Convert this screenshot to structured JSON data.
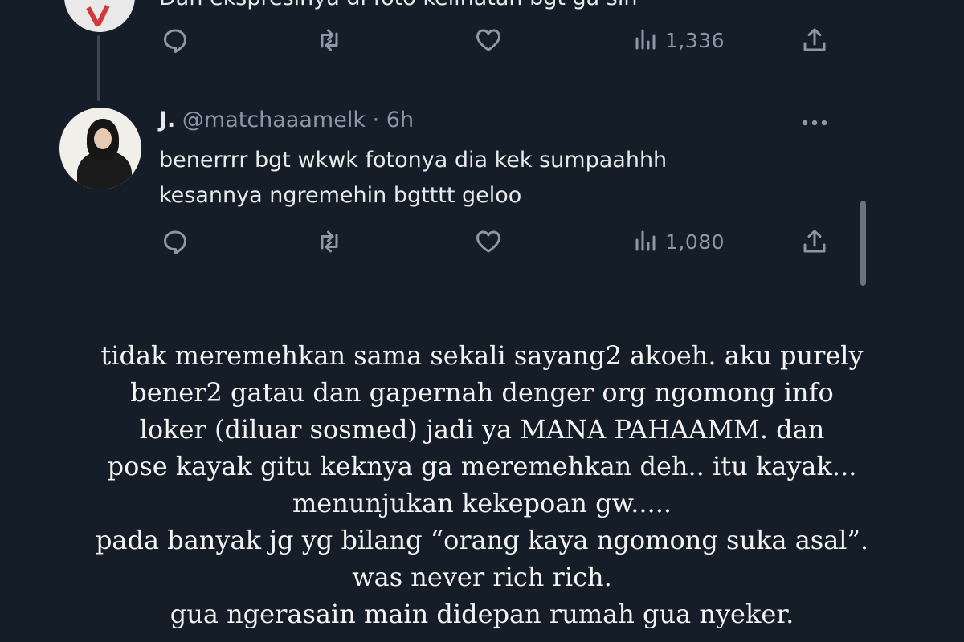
{
  "top_tweet": {
    "partial_text": "Dan ekspresinya di foto kelihatan bgt ga sih",
    "views": "1,336"
  },
  "reply": {
    "name": "J.",
    "handle": "@matchaaamelk",
    "separator": "·",
    "time": "6h",
    "text_lines": [
      "benerrrr bgt wkwk fotonya dia kek sumpaahhh",
      "kesannya ngremehin bgtttt geloo"
    ],
    "views": "1,080"
  },
  "story_lines": [
    "tidak meremehkan sama sekali sayang2 akoeh. aku purely",
    "bener2 gatau dan gapernah denger org ngomong info",
    "loker (diluar sosmed) jadi ya MANA PAHAAMM. dan",
    "pose kayak gitu keknya ga meremehkan deh.. itu kayak...",
    "menunjukan kekepoan gw.....",
    "pada banyak jg yg bilang “orang kaya ngomong suka asal”.",
    "was never rich rich.",
    "gua ngerasain main didepan rumah gua nyeker."
  ],
  "icons": {
    "reply": "reply-icon",
    "retweet": "retweet-icon",
    "like": "like-icon",
    "views": "views-icon",
    "share": "share-icon",
    "more": "more-icon"
  },
  "colors": {
    "background": "#151d29",
    "text": "#e7e9ea",
    "muted": "#8b98a5"
  }
}
